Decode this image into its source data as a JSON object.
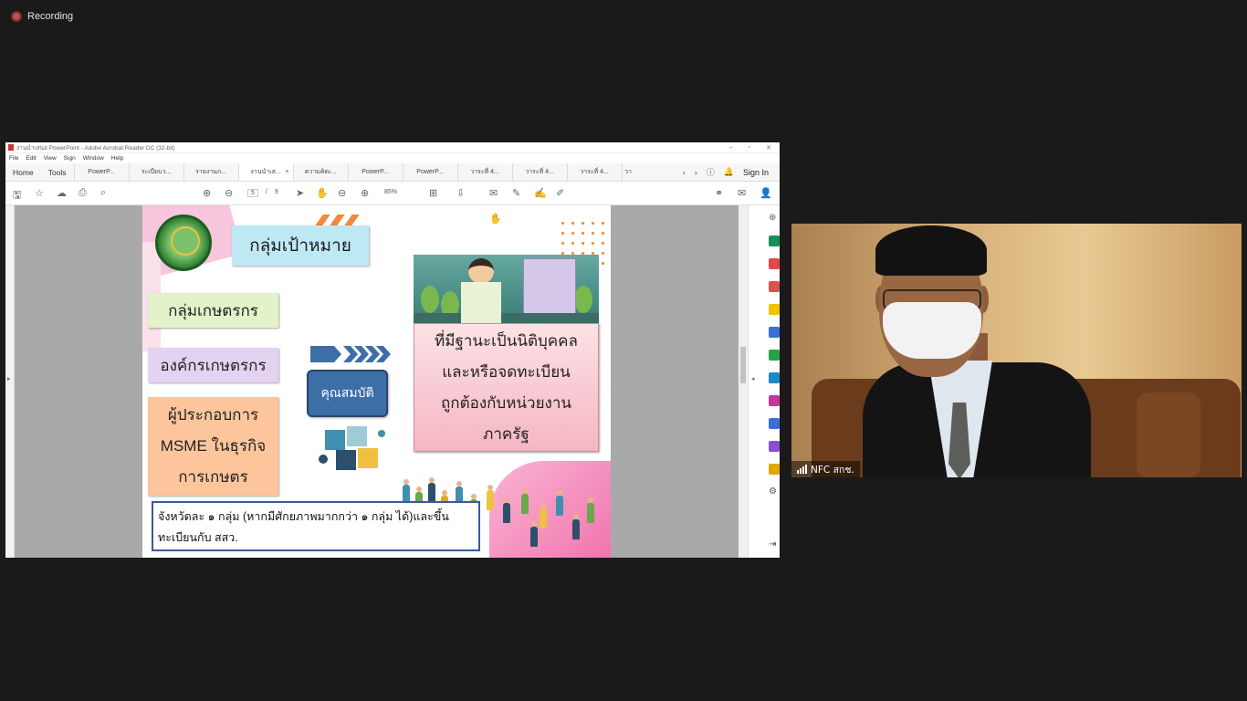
{
  "recording": {
    "label": "Recording"
  },
  "acrobat": {
    "window_title": "งานนำเสนอ PowerPoint - Adobe Acrobat Reader DC (32-bit)",
    "menu": [
      "File",
      "Edit",
      "View",
      "Sign",
      "Window",
      "Help"
    ],
    "home": "Home",
    "tools": "Tools",
    "tabs": [
      {
        "label": "PowerP..."
      },
      {
        "label": "ระเบียบว..."
      },
      {
        "label": "รายงานก..."
      },
      {
        "label": "งานนำเส..."
      },
      {
        "label": "ความคิดเ..."
      },
      {
        "label": "PowerP..."
      },
      {
        "label": "PowerP..."
      },
      {
        "label": "วาระที่ 4..."
      },
      {
        "label": "วาระที่ 4..."
      },
      {
        "label": "วาระที่ 4..."
      },
      {
        "label": "วา"
      }
    ],
    "active_tab_index": 3,
    "sign_in": "Sign In",
    "page": {
      "current": "5",
      "total": "9"
    },
    "zoom": "85%"
  },
  "slide": {
    "title": "กลุ่มเป้าหมาย",
    "group_1": "กลุ่มเกษตรกร",
    "group_2": "องค์กรเกษตรกร",
    "group_3_lines": [
      "ผู้ประกอบการ",
      "MSME ในธุรกิจ",
      "การเกษตร"
    ],
    "qualification": "คุณสมบัติ",
    "condition_lines": [
      "ที่มีฐานะเป็นนิติบุคคล",
      "และหรือจดทะเบียน",
      "ถูกต้องกับหน่วยงาน",
      "ภาครัฐ"
    ],
    "note_lines": [
      "จังหวัดละ ๑ กลุ่ม (หากมีศักยภาพมากกว่า ๑ กลุ่ม ได้)และขึ้น",
      "ทะเบียนกับ สสว."
    ]
  },
  "webcam": {
    "participant_name": "NFC สกช."
  },
  "colors": {
    "title_box": "#bfe8f5",
    "group_1": "#e2f2c9",
    "group_2": "#e4d2f2",
    "group_3": "#fcc59b",
    "qualification": "#3d6ea7",
    "note_border": "#3d5a93"
  }
}
